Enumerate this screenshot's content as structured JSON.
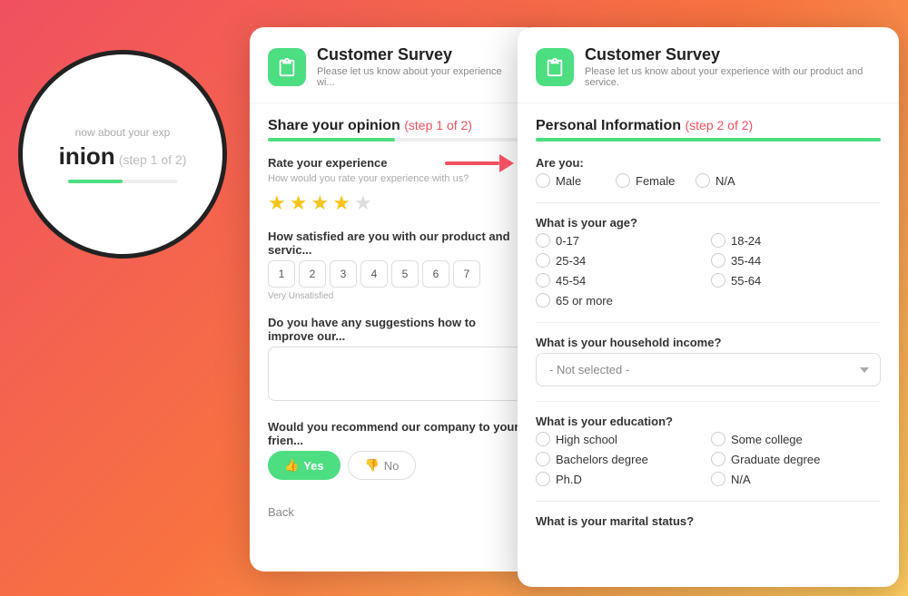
{
  "background": {
    "gradient": "linear-gradient(135deg, #f05060, #f87340, #ffd060)"
  },
  "circle_zoom": {
    "title": "inion",
    "subtitle": "(step 1 of 2)",
    "top_text": "now about your exp"
  },
  "arrow": {
    "color": "#f05060"
  },
  "step1_panel": {
    "header": {
      "icon_alt": "clipboard-icon",
      "title": "Customer Survey",
      "subtitle": "Please let us know about your experience wi..."
    },
    "section_title": "Share your opinion",
    "step_label": "(step 1 of 2)",
    "progress_pct": 50,
    "questions": [
      {
        "id": "rate_experience",
        "label": "Rate your experience",
        "sub": "How would you rate your experience with us?",
        "type": "stars",
        "value": 4,
        "max": 5
      },
      {
        "id": "satisfied",
        "label": "How satisfied are you with our product and servic...",
        "type": "scale",
        "options": [
          "1",
          "2",
          "3",
          "4",
          "5",
          "6",
          "7"
        ],
        "sub_label": "Very Unsatisfied"
      },
      {
        "id": "suggestions",
        "label": "Do you have any suggestions how to improve our...",
        "type": "textarea",
        "placeholder": ""
      },
      {
        "id": "recommend",
        "label": "Would you recommend our company to your frien...",
        "type": "yesno",
        "yes_label": "Yes",
        "no_label": "No"
      }
    ],
    "back_label": "Back"
  },
  "step2_panel": {
    "header": {
      "icon_alt": "clipboard-icon",
      "title": "Customer Survey",
      "subtitle": "Please let us know about your experience with our product and service."
    },
    "section_title": "Personal Information",
    "step_label": "(step 2 of 2)",
    "progress_pct": 100,
    "questions": [
      {
        "id": "gender",
        "label": "Are you:",
        "type": "radio",
        "options": [
          "Male",
          "Female",
          "N/A"
        ]
      },
      {
        "id": "age",
        "label": "What is your age?",
        "type": "radio_grid",
        "options": [
          "0-17",
          "18-24",
          "25-34",
          "35-44",
          "45-54",
          "55-64",
          "65 or more"
        ]
      },
      {
        "id": "income",
        "label": "What is your household income?",
        "type": "dropdown",
        "value": "- Not selected -"
      },
      {
        "id": "education",
        "label": "What is your education?",
        "type": "radio_grid",
        "options": [
          "High school",
          "Some college",
          "Bachelors degree",
          "Graduate degree",
          "Ph.D",
          "N/A"
        ]
      },
      {
        "id": "marital",
        "label": "What is your marital status?",
        "type": "radio_grid",
        "options": []
      }
    ]
  }
}
